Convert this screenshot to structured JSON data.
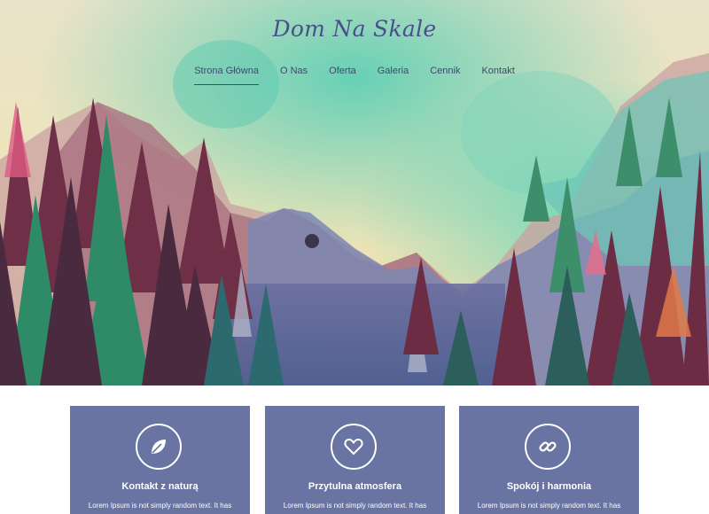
{
  "site": {
    "title": "Dom Na Skale"
  },
  "nav": {
    "items": [
      {
        "label": "Strona Główna",
        "active": true
      },
      {
        "label": "O Nas"
      },
      {
        "label": "Oferta"
      },
      {
        "label": "Galeria"
      },
      {
        "label": "Cennik"
      },
      {
        "label": "Kontakt"
      }
    ]
  },
  "features": [
    {
      "icon": "leaf-icon",
      "title": "Kontakt z naturą",
      "text": "Lorem Ipsum is not simply random text. It has"
    },
    {
      "icon": "heart-icon",
      "title": "Przytulna atmosfera",
      "text": "Lorem Ipsum is not simply random text. It has"
    },
    {
      "icon": "link-icon",
      "title": "Spokój i harmonia",
      "text": "Lorem Ipsum is not simply random text. It has"
    }
  ],
  "colors": {
    "card_bg": "#6a74a3",
    "title": "#4a4f8c",
    "nav_text": "#3e4a6e"
  }
}
